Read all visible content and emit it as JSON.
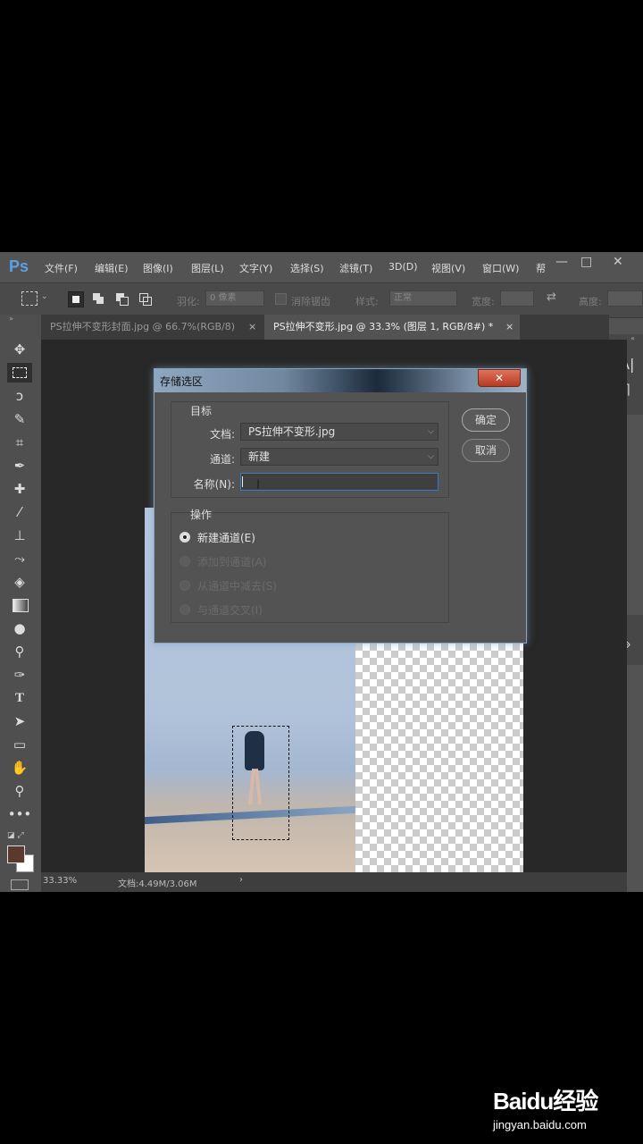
{
  "app": {
    "logo": "Ps",
    "menu": [
      "文件(F)",
      "编辑(E)",
      "图像(I)",
      "图层(L)",
      "文字(Y)",
      "选择(S)",
      "滤镜(T)",
      "3D(D)",
      "视图(V)",
      "窗口(W)"
    ],
    "menu_overflow": "帮",
    "window_controls": [
      "—",
      "□",
      "✕"
    ]
  },
  "options_bar": {
    "feather_label": "羽化:",
    "feather_value": "0 像素",
    "antialias_label": "消除锯齿",
    "style_label": "样式:",
    "style_value": "正常",
    "width_label": "宽度:",
    "height_label": "高度:"
  },
  "tabs": [
    {
      "title": "PS拉伸不变形封面.jpg @ 66.7%(RGB/8)",
      "close": "×"
    },
    {
      "title": "PS拉伸不变形.jpg @ 33.3% (图层 1, RGB/8#) *",
      "close": "×"
    }
  ],
  "status": {
    "zoom": "33.33%",
    "doc": "文档:4.49M/3.06M",
    "arrow": "›"
  },
  "dialog": {
    "title": "存储选区",
    "close": "✕",
    "target_group": "目标",
    "document_label": "文档:",
    "document_value": "PS拉伸不变形.jpg",
    "channel_label": "通道:",
    "channel_value": "新建",
    "name_label": "名称(N):",
    "name_value": "",
    "ok": "确定",
    "cancel": "取消",
    "operation_group": "操作",
    "options": [
      {
        "label": "新建通道(E)",
        "selected": true,
        "enabled": true
      },
      {
        "label": "添加到通道(A)",
        "selected": false,
        "enabled": false
      },
      {
        "label": "从通道中减去(S)",
        "selected": false,
        "enabled": false
      },
      {
        "label": "与通道交叉(I)",
        "selected": false,
        "enabled": false
      }
    ]
  },
  "watermark": {
    "brand": "Baidu经验",
    "url": "jingyan.baidu.com"
  },
  "colors": {
    "accent": "#5aa0e6",
    "foreground": "#5a3a2e",
    "background": "#ffffff"
  }
}
